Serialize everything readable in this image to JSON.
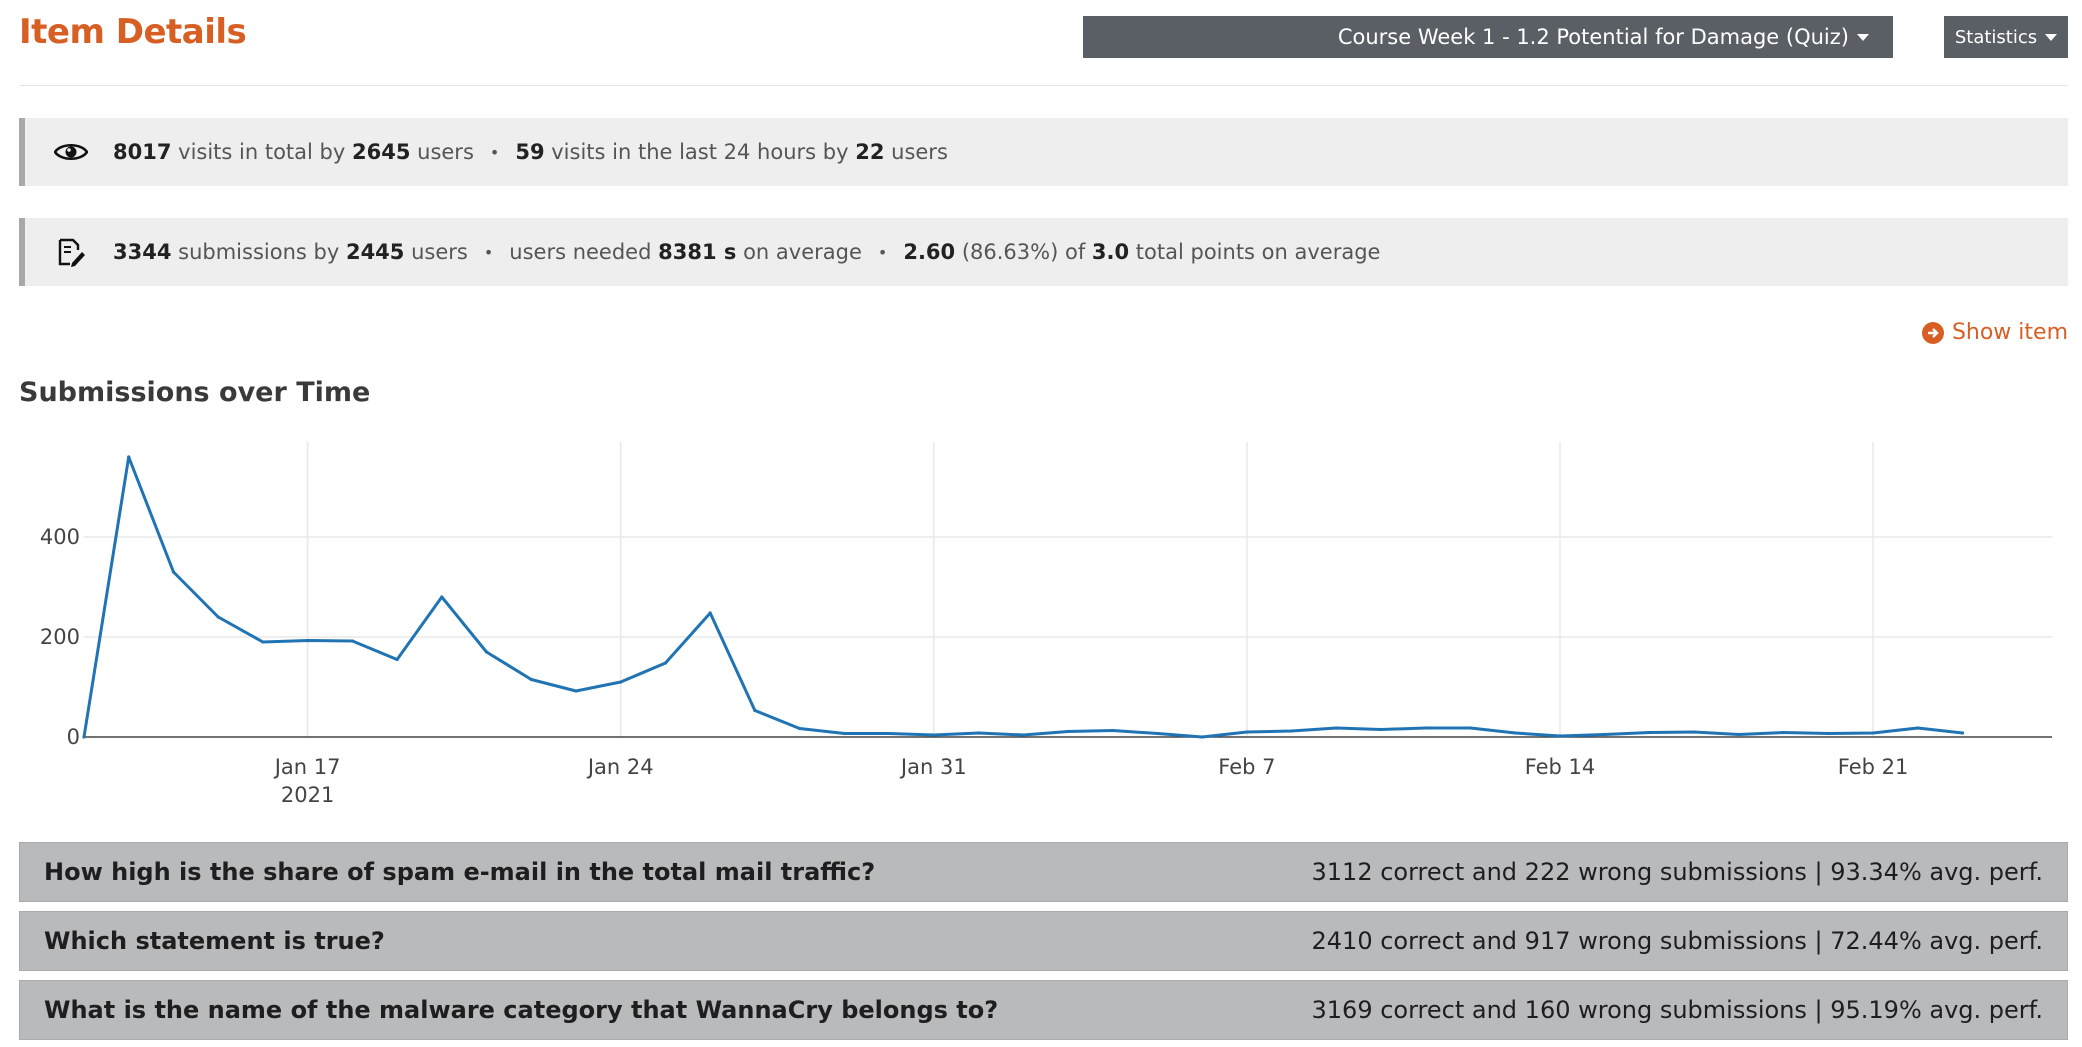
{
  "header": {
    "title": "Item Details",
    "item_selector": "Course Week 1 - 1.2 Potential for Damage (Quiz)",
    "statistics_label": "Statistics"
  },
  "visits": {
    "icon": "eye-icon",
    "total_visits": "8017",
    "text_visits": "visits in total by",
    "total_users": "2645",
    "text_users": "users",
    "recent_visits": "59",
    "text_recent": "visits in the last 24 hours by",
    "recent_users": "22",
    "text_recent_users": "users"
  },
  "submissions": {
    "icon": "edit-document-icon",
    "count": "3344",
    "text_count": "submissions by",
    "users": "2445",
    "text_users": "users",
    "text_needed": "users needed",
    "avg_time": "8381 s",
    "text_avg": "on average",
    "avg_points": "2.60",
    "avg_percent": "(86.63%) of",
    "max_points": "3.0",
    "text_points": "total points on average"
  },
  "show_item": {
    "label": "Show item",
    "icon": "arrow-circle-right-icon"
  },
  "chart_section": {
    "title": "Submissions over Time"
  },
  "chart_data": {
    "type": "line",
    "title": "Submissions over Time",
    "xlabel": "",
    "ylabel": "",
    "x_start": "2021-01-12",
    "x_end": "2021-02-25",
    "x_tick_labels": [
      "Jan 17",
      "Jan 24",
      "Jan 31",
      "Feb 7",
      "Feb 14",
      "Feb 21"
    ],
    "x_tick_year": "2021",
    "y_ticks": [
      0,
      200,
      400
    ],
    "ylim": [
      0,
      590
    ],
    "grid": true,
    "series": [
      {
        "name": "",
        "color": "#2074b4",
        "x": [
          "2021-01-12",
          "2021-01-13",
          "2021-01-14",
          "2021-01-15",
          "2021-01-16",
          "2021-01-17",
          "2021-01-18",
          "2021-01-19",
          "2021-01-20",
          "2021-01-21",
          "2021-01-22",
          "2021-01-23",
          "2021-01-24",
          "2021-01-25",
          "2021-01-26",
          "2021-01-27",
          "2021-01-28",
          "2021-01-29",
          "2021-01-30",
          "2021-01-31",
          "2021-02-01",
          "2021-02-02",
          "2021-02-03",
          "2021-02-04",
          "2021-02-05",
          "2021-02-06",
          "2021-02-07",
          "2021-02-08",
          "2021-02-09",
          "2021-02-10",
          "2021-02-11",
          "2021-02-12",
          "2021-02-13",
          "2021-02-14",
          "2021-02-15",
          "2021-02-16",
          "2021-02-17",
          "2021-02-18",
          "2021-02-19",
          "2021-02-20",
          "2021-02-21",
          "2021-02-22",
          "2021-02-23"
        ],
        "y": [
          0,
          560,
          330,
          240,
          190,
          193,
          192,
          155,
          280,
          170,
          115,
          92,
          110,
          148,
          248,
          53,
          17,
          7,
          7,
          4,
          8,
          4,
          11,
          13,
          7,
          0,
          10,
          12,
          18,
          15,
          18,
          18,
          8,
          2,
          5,
          9,
          10,
          5,
          9,
          7,
          8,
          18,
          8
        ]
      }
    ]
  },
  "questions": [
    {
      "text": "How high is the share of spam e-mail in the total mail traffic?",
      "stats": "3112 correct and 222 wrong submissions | 93.34% avg. perf."
    },
    {
      "text": "Which statement is true?",
      "stats": "2410 correct and 917 wrong submissions | 72.44% avg. perf."
    },
    {
      "text": "What is the name of the malware category that WannaCry belongs to?",
      "stats": "3169 correct and 160 wrong submissions | 95.19% avg. perf."
    }
  ]
}
